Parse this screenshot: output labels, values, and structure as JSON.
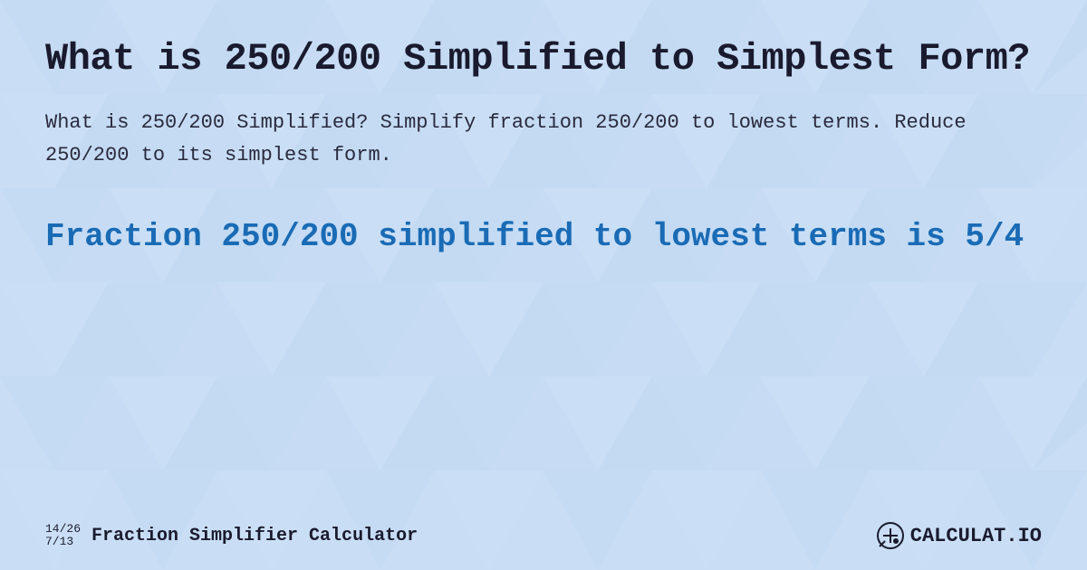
{
  "background": {
    "color": "#c9def5"
  },
  "header": {
    "title": "What is 250/200 Simplified to Simplest Form?"
  },
  "description": {
    "text": "What is 250/200 Simplified? Simplify fraction 250/200 to lowest terms. Reduce 250/200 to its simplest form."
  },
  "result": {
    "text": "Fraction 250/200 simplified to lowest terms is 5/4"
  },
  "footer": {
    "fraction_top": "14/26",
    "fraction_bottom": "7/13",
    "label": "Fraction Simplifier Calculator",
    "brand": "CALCULAT.IO"
  }
}
